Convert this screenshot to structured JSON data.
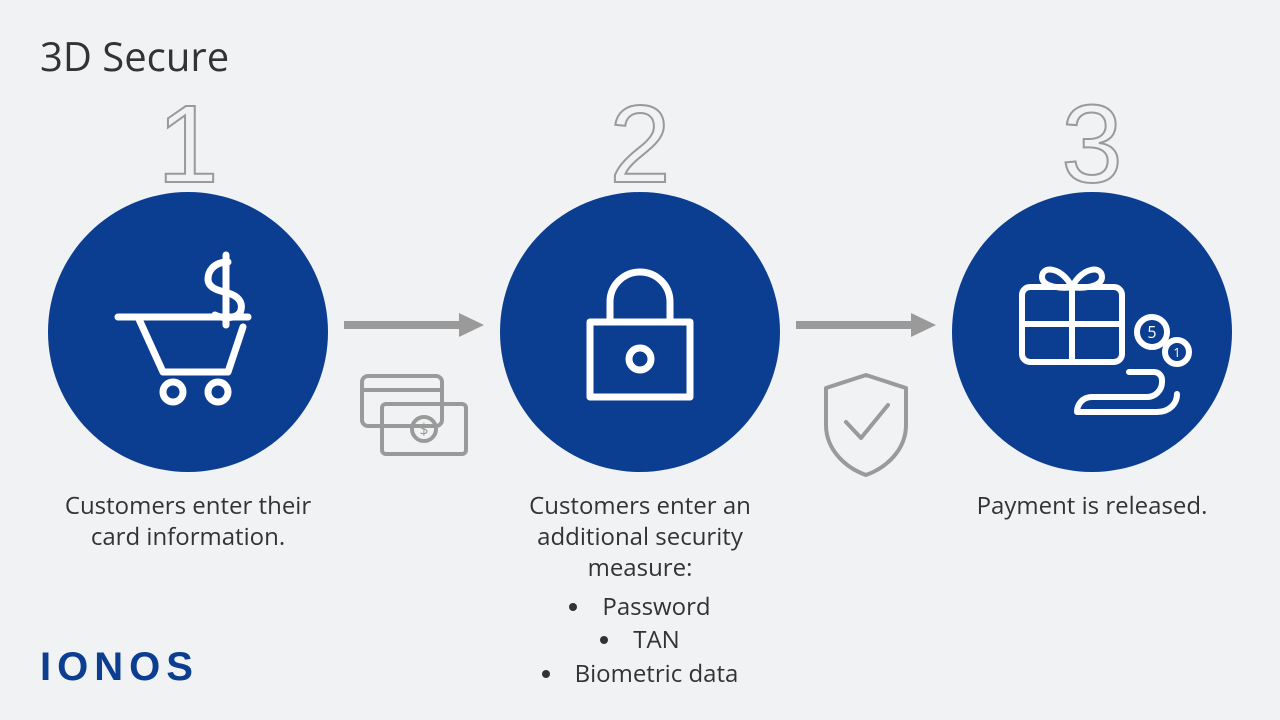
{
  "title": "3D Secure",
  "brand": "IONOS",
  "colors": {
    "circle": "#0b3d91",
    "gray": "#9a9a9a",
    "text": "#333333"
  },
  "steps": [
    {
      "number": "1",
      "icon": "cart-dollar-icon",
      "caption": "Customers enter their card information."
    },
    {
      "number": "2",
      "icon": "lock-icon",
      "caption": "Customers enter an additional security measure:",
      "bullets": [
        "Password",
        "TAN",
        "Biometric data"
      ]
    },
    {
      "number": "3",
      "icon": "gift-hand-coins-icon",
      "caption": "Payment is released."
    }
  ],
  "connectors": [
    {
      "under_icon": "credit-card-cash-icon"
    },
    {
      "under_icon": "shield-check-icon"
    }
  ]
}
